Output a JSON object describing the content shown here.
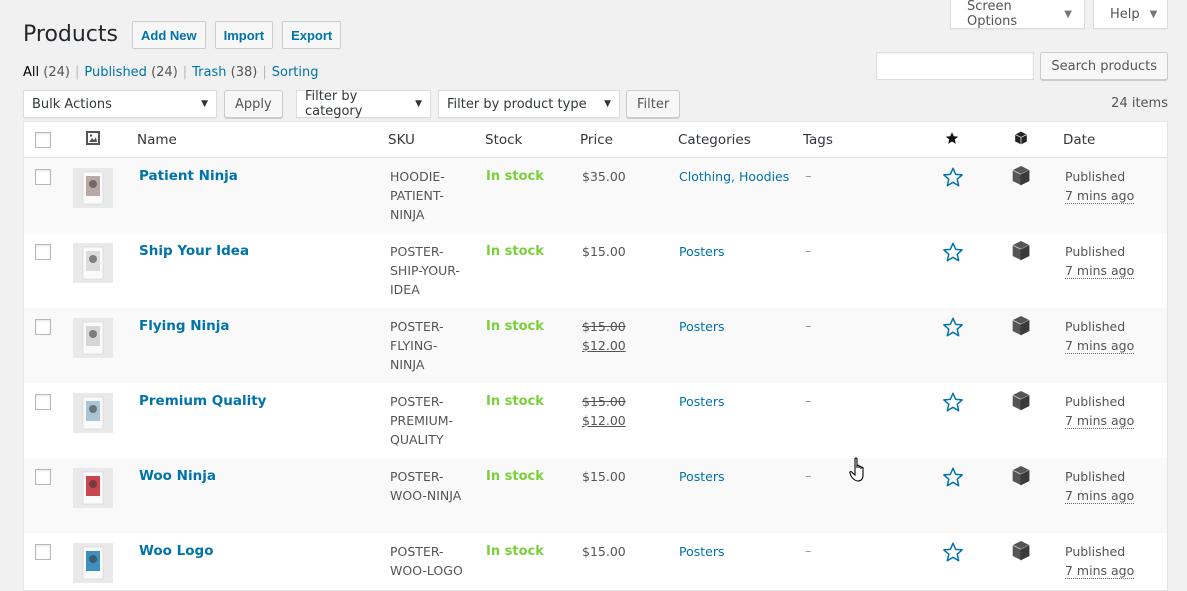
{
  "screen_meta": {
    "screen_options": "Screen Options",
    "help": "Help"
  },
  "header": {
    "title": "Products",
    "actions": [
      "Add New",
      "Import",
      "Export"
    ]
  },
  "views": [
    {
      "label": "All",
      "count": "(24)",
      "current": true
    },
    {
      "label": "Published",
      "count": "(24)"
    },
    {
      "label": "Trash",
      "count": "(38)"
    },
    {
      "label": "Sorting",
      "count": ""
    }
  ],
  "search": {
    "value": "",
    "button": "Search products"
  },
  "tablenav": {
    "bulk_actions": "Bulk Actions",
    "apply": "Apply",
    "filter_category": "Filter by category",
    "filter_type": "Filter by product type",
    "filter": "Filter",
    "items_count": "24 items"
  },
  "columns": {
    "name": "Name",
    "sku": "SKU",
    "stock": "Stock",
    "price": "Price",
    "categories": "Categories",
    "tags": "Tags",
    "date": "Date"
  },
  "products": [
    {
      "name": "Patient Ninja",
      "sku": "HOODIE-PATIENT-NINJA",
      "sku_lines": [
        "HOODIE-",
        "PATIENT-",
        "NINJA"
      ],
      "stock": "In stock",
      "price": "$35.00",
      "sale_from": "",
      "sale_to": "",
      "categories": "Clothing, Hoodies",
      "tags": "–",
      "status": "Published",
      "ago": "7 mins ago",
      "thumb_color": "#b8a9a6"
    },
    {
      "name": "Ship Your Idea",
      "sku": "POSTER-SHIP-YOUR-IDEA",
      "sku_lines": [
        "POSTER-",
        "SHIP-YOUR-",
        "IDEA"
      ],
      "stock": "In stock",
      "price": "$15.00",
      "sale_from": "",
      "sale_to": "",
      "categories": "Posters",
      "tags": "–",
      "status": "Published",
      "ago": "7 mins ago",
      "thumb_color": "#dcdcdc"
    },
    {
      "name": "Flying Ninja",
      "sku": "POSTER-FLYING-NINJA",
      "sku_lines": [
        "POSTER-",
        "FLYING-",
        "NINJA"
      ],
      "stock": "In stock",
      "price": "",
      "sale_from": "$15.00",
      "sale_to": "$12.00",
      "categories": "Posters",
      "tags": "–",
      "status": "Published",
      "ago": "7 mins ago",
      "thumb_color": "#d6d6d6"
    },
    {
      "name": "Premium Quality",
      "sku": "POSTER-PREMIUM-QUALITY",
      "sku_lines": [
        "POSTER-",
        "PREMIUM-",
        "QUALITY"
      ],
      "stock": "In stock",
      "price": "",
      "sale_from": "$15.00",
      "sale_to": "$12.00",
      "categories": "Posters",
      "tags": "–",
      "status": "Published",
      "ago": "7 mins ago",
      "thumb_color": "#a9c4d6"
    },
    {
      "name": "Woo Ninja",
      "sku": "POSTER-WOO-NINJA",
      "sku_lines": [
        "POSTER-",
        "WOO-NINJA"
      ],
      "stock": "In stock",
      "price": "$15.00",
      "sale_from": "",
      "sale_to": "",
      "categories": "Posters",
      "tags": "–",
      "status": "Published",
      "ago": "7 mins ago",
      "thumb_color": "#c9454f"
    },
    {
      "name": "Woo Logo",
      "sku": "POSTER-WOO-LOGO",
      "sku_lines": [
        "POSTER-",
        "WOO-LOGO"
      ],
      "stock": "In stock",
      "price": "$15.00",
      "sale_from": "",
      "sale_to": "",
      "categories": "Posters",
      "tags": "–",
      "status": "Published",
      "ago": "7 mins ago",
      "thumb_color": "#3f8fbf"
    }
  ],
  "icons": {
    "image_column": "image-icon",
    "featured_column": "star-filled-icon",
    "type_column": "box-icon",
    "featured": "star-outline-icon",
    "product_type": "box-icon"
  }
}
